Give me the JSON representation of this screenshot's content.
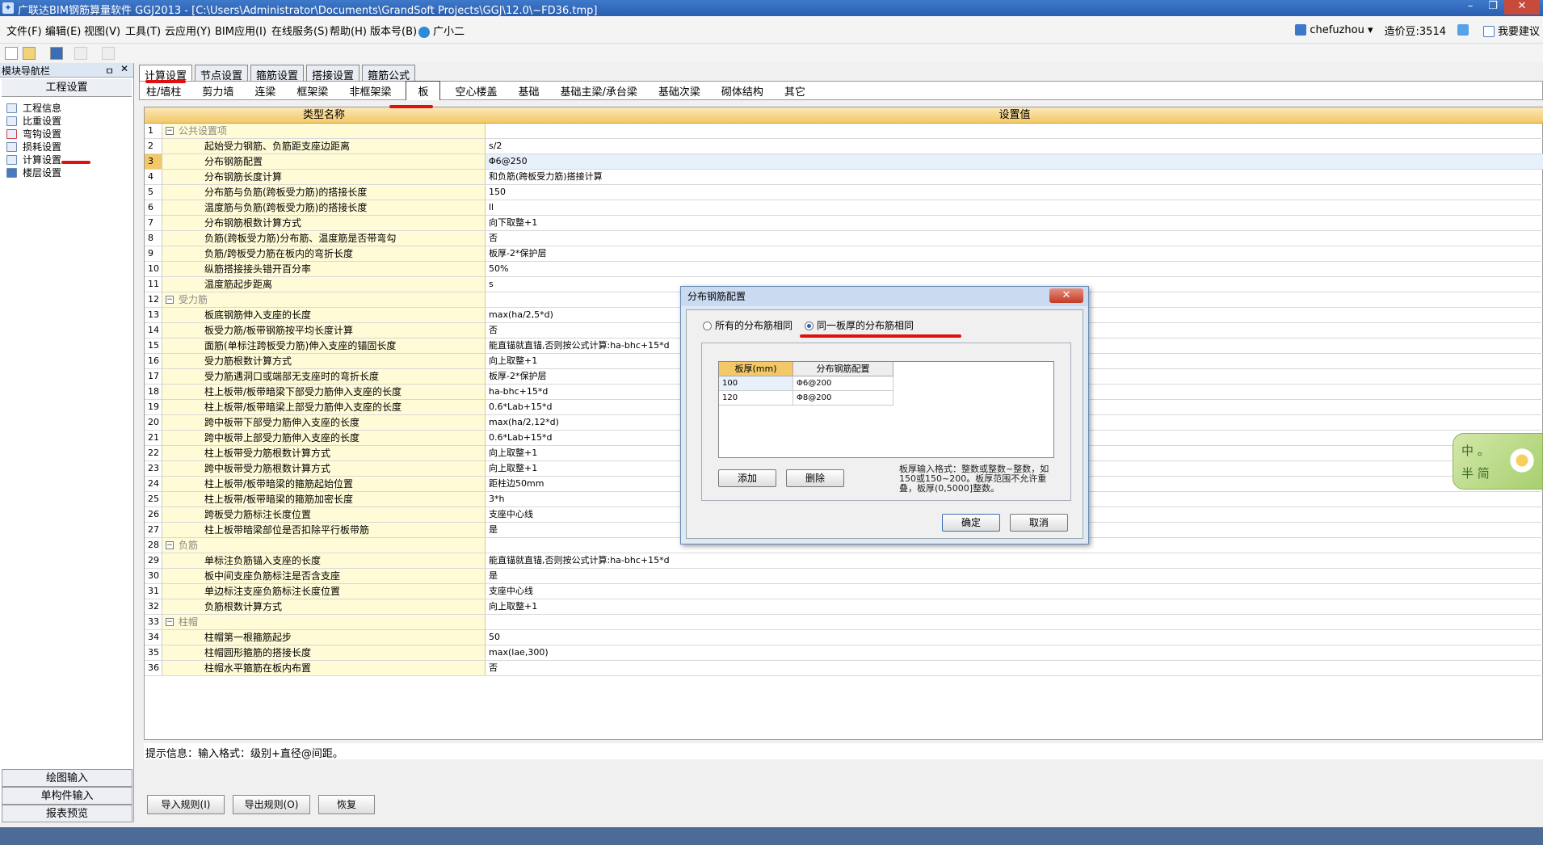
{
  "window": {
    "title": "广联达BIM钢筋算量软件 GGJ2013 - [C:\\Users\\Administrator\\Documents\\GrandSoft Projects\\GGJ\\12.0\\~FD36.tmp]",
    "btn_min": "–",
    "btn_max": "❐",
    "btn_close": "✕"
  },
  "menu": [
    "文件(F)",
    "编辑(E)",
    "视图(V)",
    "工具(T)",
    "云应用(Y)",
    "BIM应用(I)",
    "在线服务(S)",
    "帮助(H)",
    "版本号(B)",
    "广小二"
  ],
  "user": {
    "name": "chefuzhou",
    "beans": "造价豆:3514",
    "suggest": "我要建议"
  },
  "nav": {
    "title": "模块导航栏",
    "pin": "ㅁ",
    "close": "✕",
    "section": "工程设置",
    "items": [
      "工程信息",
      "比重设置",
      "弯钩设置",
      "损耗设置",
      "计算设置",
      "楼层设置"
    ],
    "bottom": [
      "绘图输入",
      "单构件输入",
      "报表预览"
    ]
  },
  "tabs": [
    "计算设置",
    "节点设置",
    "箍筋设置",
    "搭接设置",
    "箍筋公式"
  ],
  "subtabs": [
    "柱/墙柱",
    "剪力墙",
    "连梁",
    "框架梁",
    "非框架梁",
    "板",
    "空心楼盖",
    "基础",
    "基础主梁/承台梁",
    "基础次梁",
    "砌体结构",
    "其它"
  ],
  "grid": {
    "col_name": "类型名称",
    "col_value": "设置值",
    "rows": [
      {
        "n": "1",
        "type": "group",
        "name": "公共设置项",
        "value": ""
      },
      {
        "n": "2",
        "type": "item",
        "name": "起始受力钢筋、负筋距支座边距离",
        "value": "s/2"
      },
      {
        "n": "3",
        "type": "item",
        "name": "分布钢筋配置",
        "value": "Φ6@250"
      },
      {
        "n": "4",
        "type": "item",
        "name": "分布钢筋长度计算",
        "value": "和负筋(跨板受力筋)搭接计算"
      },
      {
        "n": "5",
        "type": "item",
        "name": "分布筋与负筋(跨板受力筋)的搭接长度",
        "value": "150"
      },
      {
        "n": "6",
        "type": "item",
        "name": "温度筋与负筋(跨板受力筋)的搭接长度",
        "value": "ll"
      },
      {
        "n": "7",
        "type": "item",
        "name": "分布钢筋根数计算方式",
        "value": "向下取整+1"
      },
      {
        "n": "8",
        "type": "item",
        "name": "负筋(跨板受力筋)分布筋、温度筋是否带弯勾",
        "value": "否"
      },
      {
        "n": "9",
        "type": "item",
        "name": "负筋/跨板受力筋在板内的弯折长度",
        "value": "板厚-2*保护层"
      },
      {
        "n": "10",
        "type": "item",
        "name": "纵筋搭接接头错开百分率",
        "value": "50%"
      },
      {
        "n": "11",
        "type": "item",
        "name": "温度筋起步距离",
        "value": "s"
      },
      {
        "n": "12",
        "type": "group",
        "name": "受力筋",
        "value": ""
      },
      {
        "n": "13",
        "type": "item",
        "name": "板底钢筋伸入支座的长度",
        "value": "max(ha/2,5*d)"
      },
      {
        "n": "14",
        "type": "item",
        "name": "板受力筋/板带钢筋按平均长度计算",
        "value": "否"
      },
      {
        "n": "15",
        "type": "item",
        "name": "面筋(单标注跨板受力筋)伸入支座的锚固长度",
        "value": "能直锚就直锚,否则按公式计算:ha-bhc+15*d"
      },
      {
        "n": "16",
        "type": "item",
        "name": "受力筋根数计算方式",
        "value": "向上取整+1"
      },
      {
        "n": "17",
        "type": "item",
        "name": "受力筋遇洞口或端部无支座时的弯折长度",
        "value": "板厚-2*保护层"
      },
      {
        "n": "18",
        "type": "item",
        "name": "柱上板带/板带暗梁下部受力筋伸入支座的长度",
        "value": "ha-bhc+15*d"
      },
      {
        "n": "19",
        "type": "item",
        "name": "柱上板带/板带暗梁上部受力筋伸入支座的长度",
        "value": "0.6*Lab+15*d"
      },
      {
        "n": "20",
        "type": "item",
        "name": "跨中板带下部受力筋伸入支座的长度",
        "value": "max(ha/2,12*d)"
      },
      {
        "n": "21",
        "type": "item",
        "name": "跨中板带上部受力筋伸入支座的长度",
        "value": "0.6*Lab+15*d"
      },
      {
        "n": "22",
        "type": "item",
        "name": "柱上板带受力筋根数计算方式",
        "value": "向上取整+1"
      },
      {
        "n": "23",
        "type": "item",
        "name": "跨中板带受力筋根数计算方式",
        "value": "向上取整+1"
      },
      {
        "n": "24",
        "type": "item",
        "name": "柱上板带/板带暗梁的箍筋起始位置",
        "value": "距柱边50mm"
      },
      {
        "n": "25",
        "type": "item",
        "name": "柱上板带/板带暗梁的箍筋加密长度",
        "value": "3*h"
      },
      {
        "n": "26",
        "type": "item",
        "name": "跨板受力筋标注长度位置",
        "value": "支座中心线"
      },
      {
        "n": "27",
        "type": "item",
        "name": "柱上板带暗梁部位是否扣除平行板带筋",
        "value": "是"
      },
      {
        "n": "28",
        "type": "group",
        "name": "负筋",
        "value": ""
      },
      {
        "n": "29",
        "type": "item",
        "name": "单标注负筋锚入支座的长度",
        "value": "能直锚就直锚,否则按公式计算:ha-bhc+15*d"
      },
      {
        "n": "30",
        "type": "item",
        "name": "板中间支座负筋标注是否含支座",
        "value": "是"
      },
      {
        "n": "31",
        "type": "item",
        "name": "单边标注支座负筋标注长度位置",
        "value": "支座中心线"
      },
      {
        "n": "32",
        "type": "item",
        "name": "负筋根数计算方式",
        "value": "向上取整+1"
      },
      {
        "n": "33",
        "type": "group",
        "name": "柱帽",
        "value": ""
      },
      {
        "n": "34",
        "type": "item",
        "name": "柱帽第一根箍筋起步",
        "value": "50"
      },
      {
        "n": "35",
        "type": "item",
        "name": "柱帽圆形箍筋的搭接长度",
        "value": "max(lae,300)"
      },
      {
        "n": "36",
        "type": "item",
        "name": "柱帽水平箍筋在板内布置",
        "value": "否"
      }
    ]
  },
  "hint": "提示信息：输入格式：级别+直径@间距。",
  "bottom_buttons": [
    "导入规则(I)",
    "导出规则(O)",
    "恢复"
  ],
  "widget": {
    "line1": "中 。",
    "line2": "半 简"
  },
  "dialog": {
    "title": "分布钢筋配置",
    "close": "✕",
    "radio1": "所有的分布筋相同",
    "radio2": "同一板厚的分布筋相同",
    "col1": "板厚(mm)",
    "col2": "分布钢筋配置",
    "rows": [
      [
        "100",
        "Φ6@200"
      ],
      [
        "120",
        "Φ8@200"
      ]
    ],
    "add": "添加",
    "delete": "删除",
    "note": "板厚输入格式：整数或整数~整数，如150或150~200。板厚范围不允许重叠，板厚(0,5000]整数。",
    "ok": "确定",
    "cancel": "取消"
  }
}
